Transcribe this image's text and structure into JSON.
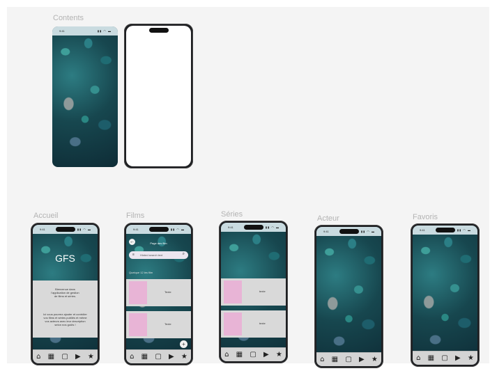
{
  "labels": {
    "contents": "Contents",
    "accueil": "Accueil",
    "films": "Films",
    "series": "Séries",
    "acteur": "Acteur",
    "favoris": "Favoris"
  },
  "status": {
    "time": "9:41",
    "icons": "▮▮ ◠ ▬"
  },
  "accueil": {
    "app_title": "GFS",
    "welcome": "Bienvenue dans l'application de gestion de films et séries.",
    "info": "Ici vous pourrez ajouter et contrôler vos films et séries publiés et même vos acteurs avec leur description selon nos goûts !"
  },
  "films": {
    "page_title": "Page des film",
    "search_placeholder": "Hinted search text",
    "section": "Quelque 12 les film",
    "cards": [
      {
        "text": "Texte"
      },
      {
        "text": "Texte"
      }
    ]
  },
  "series": {
    "cards": [
      {
        "text": "texte"
      },
      {
        "text": "texte"
      }
    ]
  },
  "nav": {
    "home": "⌂",
    "film": "▦",
    "doc": "▢",
    "play": "▶",
    "star": "★"
  },
  "colors": {
    "accent_pink": "#e8b4d6",
    "panel": "#d9d9d9",
    "status_bar": "#c9dbe0"
  }
}
